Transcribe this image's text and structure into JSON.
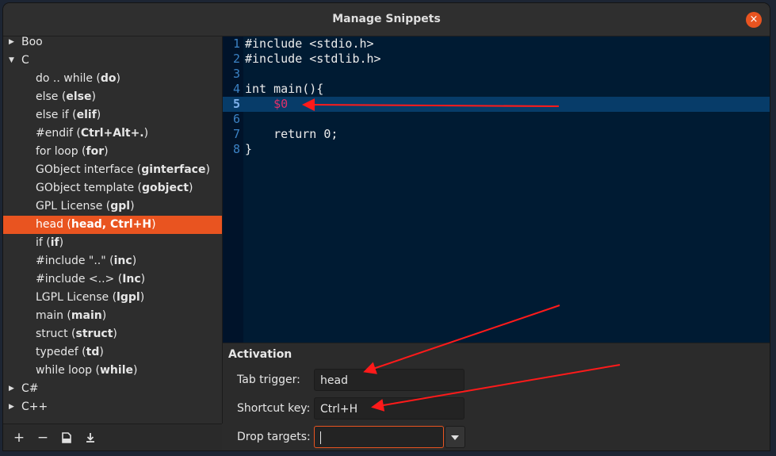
{
  "window": {
    "title": "Manage Snippets",
    "close_icon": "×"
  },
  "tree": {
    "languages_top": [
      {
        "label": "Boo",
        "expanded": false
      },
      {
        "label": "C",
        "expanded": true
      }
    ],
    "c_snippets": [
      {
        "name": "do .. while",
        "trigger": "do"
      },
      {
        "name": "else",
        "trigger": "else"
      },
      {
        "name": "else if",
        "trigger": "elif"
      },
      {
        "name": "#endif",
        "trigger": "Ctrl+Alt+."
      },
      {
        "name": "for loop",
        "trigger": "for"
      },
      {
        "name": "GObject interface",
        "trigger": "ginterface"
      },
      {
        "name": "GObject template",
        "trigger": "gobject"
      },
      {
        "name": "GPL License",
        "trigger": "gpl"
      },
      {
        "name": "head",
        "trigger": "head, Ctrl+H",
        "selected": true
      },
      {
        "name": "if",
        "trigger": "if"
      },
      {
        "name": "#include \"..\"",
        "trigger": "inc"
      },
      {
        "name": "#include <..>",
        "trigger": "Inc"
      },
      {
        "name": "LGPL License",
        "trigger": "lgpl"
      },
      {
        "name": "main",
        "trigger": "main"
      },
      {
        "name": "struct",
        "trigger": "struct"
      },
      {
        "name": "typedef",
        "trigger": "td"
      },
      {
        "name": "while loop",
        "trigger": "while"
      }
    ],
    "languages_bottom": [
      {
        "label": "C#",
        "expanded": false
      },
      {
        "label": "C++",
        "expanded": false
      }
    ],
    "toolbar": {
      "add": "+",
      "remove": "−",
      "import": "import-icon",
      "export": "export-icon"
    }
  },
  "editor": {
    "current_line": 5,
    "lines": [
      {
        "n": "1",
        "code": "#include <stdio.h>"
      },
      {
        "n": "2",
        "code": "#include <stdlib.h>"
      },
      {
        "n": "3",
        "code": ""
      },
      {
        "n": "4",
        "code": "int main(){"
      },
      {
        "n": "5",
        "code": "    ",
        "placeholder": "$0"
      },
      {
        "n": "6",
        "code": ""
      },
      {
        "n": "7",
        "code": "    return 0;"
      },
      {
        "n": "8",
        "code": "}"
      }
    ]
  },
  "activation": {
    "title": "Activation",
    "tab_trigger_label": "Tab trigger:",
    "tab_trigger_value": "head",
    "shortcut_label": "Shortcut key:",
    "shortcut_value": "Ctrl+H",
    "drop_targets_label": "Drop targets:",
    "drop_targets_value": ""
  },
  "colors": {
    "accent": "#e95420",
    "editor_bg": "#001b33",
    "current_line": "#073c69",
    "annotation": "#ff1a1a"
  }
}
